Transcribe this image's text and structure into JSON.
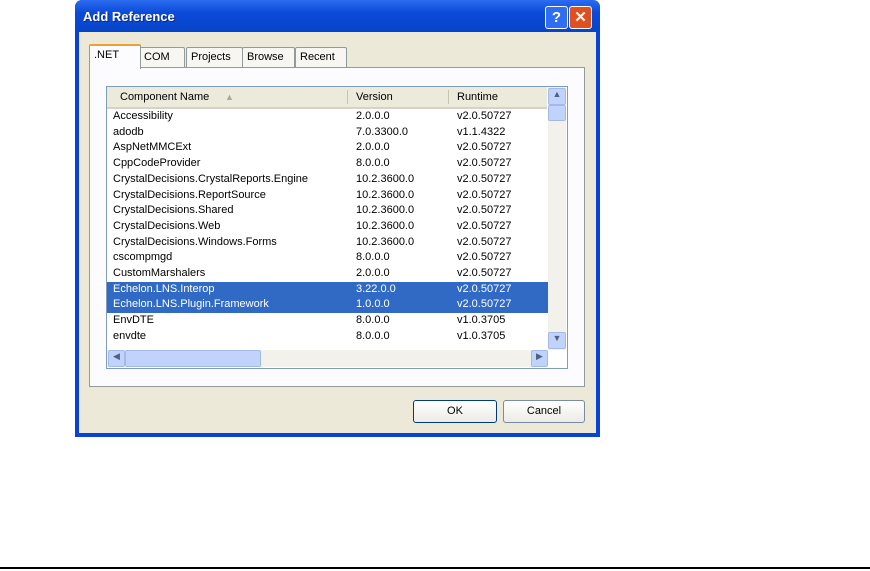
{
  "window": {
    "title": "Add Reference",
    "help_glyph": "?",
    "close_glyph": "✕"
  },
  "tabs": [
    {
      "label": ".NET"
    },
    {
      "label": "COM"
    },
    {
      "label": "Projects"
    },
    {
      "label": "Browse"
    },
    {
      "label": "Recent"
    }
  ],
  "list": {
    "columns": [
      "Component Name",
      "Version",
      "Runtime"
    ],
    "sort_glyph": "▲",
    "rows": [
      [
        "Accessibility",
        "2.0.0.0",
        "v2.0.50727"
      ],
      [
        "adodb",
        "7.0.3300.0",
        "v1.1.4322"
      ],
      [
        "AspNetMMCExt",
        "2.0.0.0",
        "v2.0.50727"
      ],
      [
        "CppCodeProvider",
        "8.0.0.0",
        "v2.0.50727"
      ],
      [
        "CrystalDecisions.CrystalReports.Engine",
        "10.2.3600.0",
        "v2.0.50727"
      ],
      [
        "CrystalDecisions.ReportSource",
        "10.2.3600.0",
        "v2.0.50727"
      ],
      [
        "CrystalDecisions.Shared",
        "10.2.3600.0",
        "v2.0.50727"
      ],
      [
        "CrystalDecisions.Web",
        "10.2.3600.0",
        "v2.0.50727"
      ],
      [
        "CrystalDecisions.Windows.Forms",
        "10.2.3600.0",
        "v2.0.50727"
      ],
      [
        "cscompmgd",
        "8.0.0.0",
        "v2.0.50727"
      ],
      [
        "CustomMarshalers",
        "2.0.0.0",
        "v2.0.50727"
      ],
      [
        "Echelon.LNS.Interop",
        "3.22.0.0",
        "v2.0.50727"
      ],
      [
        "Echelon.LNS.Plugin.Framework",
        "1.0.0.0",
        "v2.0.50727"
      ],
      [
        "EnvDTE",
        "8.0.0.0",
        "v1.0.3705"
      ],
      [
        "envdte",
        "8.0.0.0",
        "v1.0.3705"
      ]
    ],
    "selected": [
      11,
      12
    ]
  },
  "buttons": {
    "ok": "OK",
    "cancel": "Cancel"
  }
}
